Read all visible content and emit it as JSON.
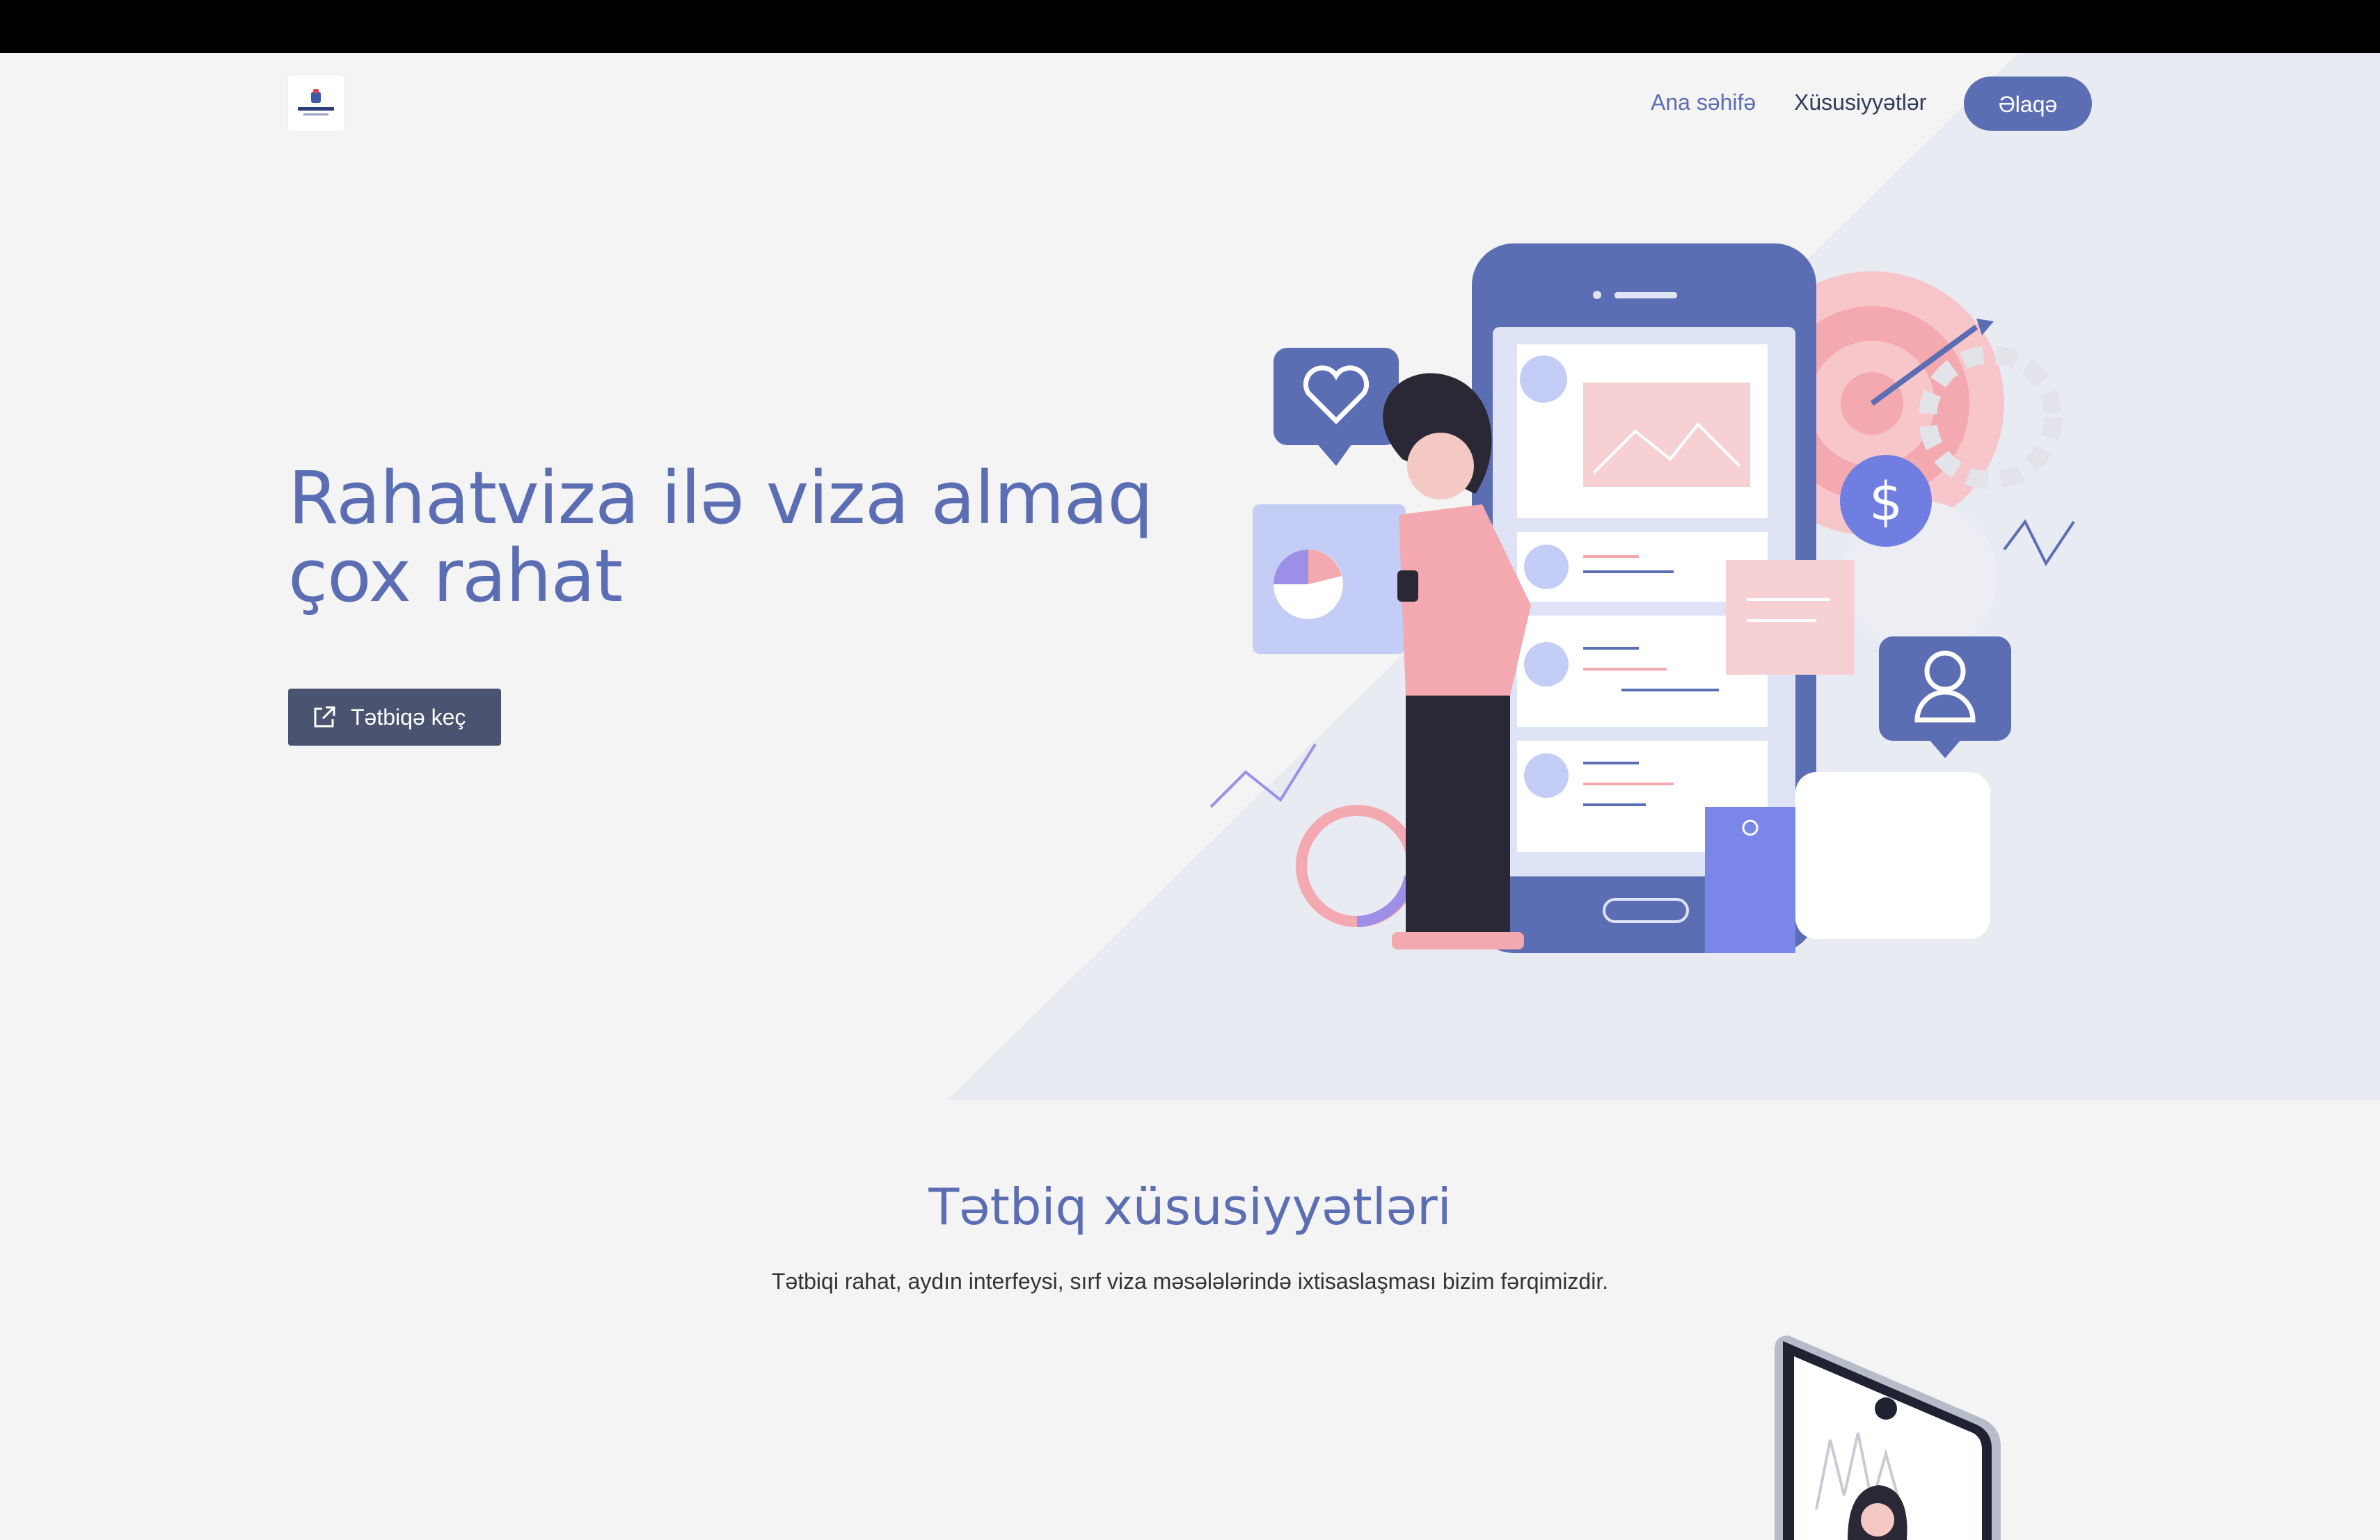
{
  "header": {
    "logo_icon": "rahatviza-logo",
    "logo_text": "RAHATVIZA.AZ",
    "nav": {
      "home": "Ana səhifə",
      "features": "Xüsusiyyətlər",
      "contact": "Əlaqə"
    }
  },
  "hero": {
    "title": "Rahatviza ilə viza almaq çox rahat",
    "cta_label": "Tətbiqə keç",
    "cta_icon": "external-link-icon"
  },
  "features": {
    "title": "Tətbiq xüsusiyyətləri",
    "subtitle": "Tətbiqi rahat, aydın interfeysi, sırf viza məsələlərində ixtisaslaşması bizim fərqimizdir."
  },
  "colors": {
    "accent": "#5b6eb3",
    "dark_button": "#4a5470",
    "background": "#f4f4f4",
    "hero_diagonal": "#e9ebf3",
    "pink": "#f4a9b0"
  }
}
